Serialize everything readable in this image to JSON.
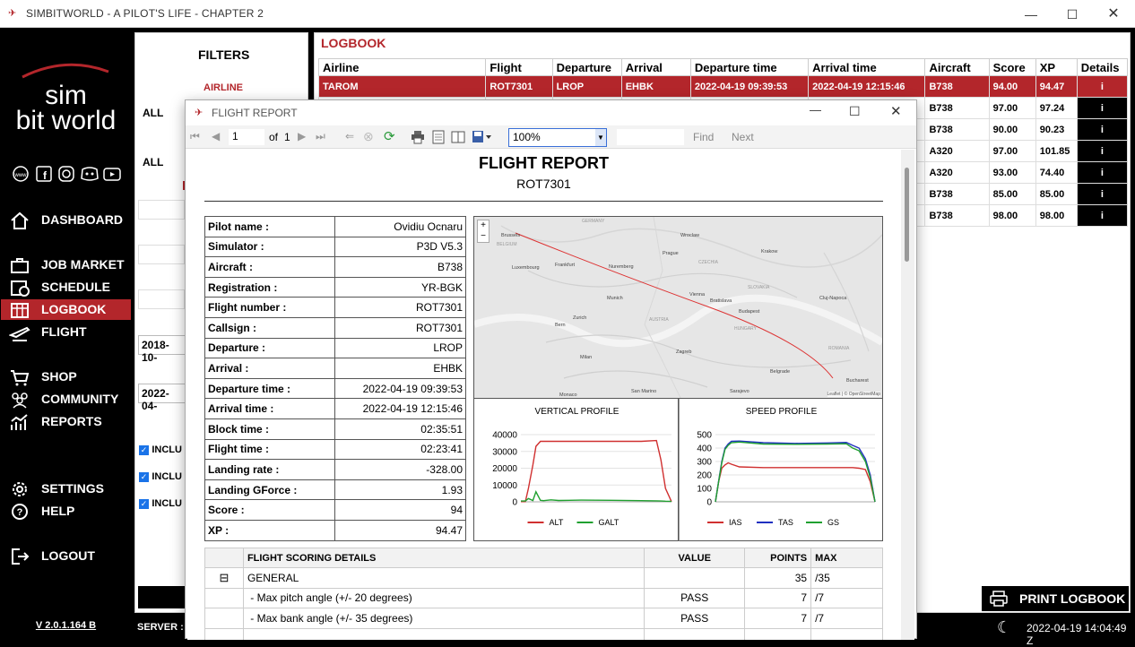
{
  "window": {
    "title": "SIMBITWORLD - A PILOT'S LIFE - CHAPTER 2"
  },
  "logo": {
    "line1": "sim",
    "line2": "bit world"
  },
  "nav": [
    {
      "label": "DASHBOARD",
      "icon": "home-icon"
    },
    {
      "label": "JOB MARKET",
      "icon": "briefcase-icon"
    },
    {
      "label": "SCHEDULE",
      "icon": "schedule-icon"
    },
    {
      "label": "LOGBOOK",
      "icon": "logbook-icon"
    },
    {
      "label": "FLIGHT",
      "icon": "plane-icon"
    },
    {
      "label": "SHOP",
      "icon": "cart-icon"
    },
    {
      "label": "COMMUNITY",
      "icon": "community-icon"
    },
    {
      "label": "REPORTS",
      "icon": "reports-icon"
    },
    {
      "label": "SETTINGS",
      "icon": "gear-icon"
    },
    {
      "label": "HELP",
      "icon": "help-icon"
    },
    {
      "label": "LOGOUT",
      "icon": "logout-icon"
    }
  ],
  "version": "V 2.0.1.164 B",
  "filters": {
    "title": "FILTERS",
    "airline_label": "AIRLINE",
    "all1": "ALL",
    "all2": "ALL",
    "date_from": "2018-10-",
    "date_to": "2022-04-",
    "include_label": "INCLU"
  },
  "logbook": {
    "title": "LOGBOOK",
    "columns": [
      "Airline",
      "Flight",
      "Departure",
      "Arrival",
      "Departure time",
      "Arrival time",
      "Aircraft",
      "Score",
      "XP",
      "Details"
    ],
    "rows": [
      {
        "airline": "TAROM",
        "flight": "ROT7301",
        "dep": "LROP",
        "arr": "EHBK",
        "dtime": "2022-04-19 09:39:53",
        "atime": "2022-04-19 12:15:46",
        "aircraft": "B738",
        "score": "94.00",
        "xp": "94.47"
      },
      {
        "aircraft": "B738",
        "score": "97.00",
        "xp": "97.24"
      },
      {
        "aircraft": "B738",
        "score": "90.00",
        "xp": "90.23"
      },
      {
        "aircraft": "A320",
        "score": "97.00",
        "xp": "101.85"
      },
      {
        "aircraft": "A320",
        "score": "93.00",
        "xp": "74.40"
      },
      {
        "aircraft": "B738",
        "score": "85.00",
        "xp": "85.00"
      },
      {
        "aircraft": "B738",
        "score": "98.00",
        "xp": "98.00"
      }
    ],
    "details_glyph": "i",
    "print_label": "PRINT LOGBOOK"
  },
  "bottombar": {
    "server_label": "SERVER : E",
    "clock": "2022-04-19 14:04:49 Z"
  },
  "dialog": {
    "title": "FLIGHT REPORT",
    "page_current": "1",
    "page_of": "of",
    "page_total": "1",
    "zoom": "100%",
    "find_label": "Find",
    "next_label": "Next"
  },
  "report": {
    "title": "FLIGHT REPORT",
    "subtitle": "ROT7301",
    "info": [
      {
        "k": "Pilot name :",
        "v": "Ovidiu Ocnaru"
      },
      {
        "k": "Simulator :",
        "v": "P3D V5.3"
      },
      {
        "k": "Aircraft :",
        "v": "B738"
      },
      {
        "k": "Registration :",
        "v": "YR-BGK"
      },
      {
        "k": "Flight number :",
        "v": "ROT7301"
      },
      {
        "k": "Callsign :",
        "v": "ROT7301"
      },
      {
        "k": "Departure :",
        "v": "LROP"
      },
      {
        "k": "Arrival :",
        "v": "EHBK"
      },
      {
        "k": "Departure time :",
        "v": "2022-04-19 09:39:53"
      },
      {
        "k": "Arrival time :",
        "v": "2022-04-19 12:15:46"
      },
      {
        "k": "Block time :",
        "v": "02:35:51"
      },
      {
        "k": "Flight time :",
        "v": "02:23:41"
      },
      {
        "k": "Landing rate :",
        "v": "-328.00"
      },
      {
        "k": "Landing GForce :",
        "v": "1.93"
      },
      {
        "k": "Score :",
        "v": "94"
      },
      {
        "k": "XP :",
        "v": "94.47"
      }
    ],
    "map": {
      "labels": [
        "GERMANY",
        "Brussels",
        "BELGIUM",
        "Luxembourg",
        "Frankfurt",
        "Nuremberg",
        "Prague",
        "CZECHIA",
        "Munich",
        "Vienna",
        "Bratislava",
        "SLOVAKIA",
        "AUSTRIA",
        "Budapest",
        "HUNGARY",
        "ROMANIA",
        "Bern",
        "Zurich",
        "Milan",
        "Zagreb",
        "Belgrade",
        "Bucharest",
        "Monaco",
        "San Marino",
        "Sarajevo",
        "Cluj-Napoca",
        "Krakow",
        "Wroclaw"
      ],
      "attribution": "Leaflet | © OpenStreetMap",
      "zoom_in": "+",
      "zoom_out": "−"
    },
    "scoring": {
      "headers": [
        "FLIGHT SCORING DETAILS",
        "VALUE",
        "POINTS",
        "MAX"
      ],
      "expand_glyph": "⊟",
      "rows": [
        {
          "label": "GENERAL",
          "value": "",
          "points": "35",
          "max": "/35"
        },
        {
          "label": " - Max pitch angle (+/- 20 degrees)",
          "value": "PASS",
          "points": "7",
          "max": "/7"
        },
        {
          "label": " - Max bank angle (+/- 35 degrees)",
          "value": "PASS",
          "points": "7",
          "max": "/7"
        }
      ]
    }
  },
  "chart_data": [
    {
      "type": "line",
      "title": "VERTICAL PROFILE",
      "ylim": [
        0,
        40000
      ],
      "yticks": [
        0,
        10000,
        20000,
        30000,
        40000
      ],
      "x": [
        0,
        3,
        5,
        8,
        10,
        13,
        15,
        20,
        25,
        40,
        60,
        80,
        90,
        93,
        96,
        100
      ],
      "series": [
        {
          "name": "ALT",
          "color": "#d03030",
          "values": [
            100,
            100,
            8000,
            22000,
            33000,
            36000,
            36000,
            36000,
            36000,
            36000,
            36000,
            36000,
            36500,
            25000,
            8000,
            100
          ]
        },
        {
          "name": "GALT",
          "color": "#20a030",
          "values": [
            500,
            500,
            2000,
            800,
            6000,
            900,
            700,
            1200,
            800,
            1000,
            900,
            700,
            600,
            500,
            400,
            300
          ]
        }
      ],
      "legend": "bottom"
    },
    {
      "type": "line",
      "title": "SPEED PROFILE",
      "ylim": [
        0,
        500
      ],
      "yticks": [
        0,
        100,
        200,
        300,
        400,
        500
      ],
      "x": [
        0,
        2,
        4,
        6,
        8,
        10,
        15,
        30,
        50,
        70,
        82,
        86,
        90,
        94,
        97,
        100
      ],
      "series": [
        {
          "name": "IAS",
          "color": "#d03030",
          "values": [
            0,
            150,
            250,
            275,
            290,
            280,
            260,
            255,
            255,
            255,
            255,
            255,
            250,
            240,
            150,
            0
          ]
        },
        {
          "name": "TAS",
          "color": "#2030c0",
          "values": [
            0,
            155,
            300,
            400,
            430,
            450,
            452,
            440,
            435,
            438,
            442,
            420,
            400,
            320,
            200,
            0
          ]
        },
        {
          "name": "GS",
          "color": "#20a030",
          "values": [
            0,
            150,
            290,
            390,
            420,
            440,
            445,
            430,
            428,
            430,
            432,
            400,
            380,
            300,
            180,
            0
          ]
        }
      ],
      "legend": "bottom"
    }
  ]
}
